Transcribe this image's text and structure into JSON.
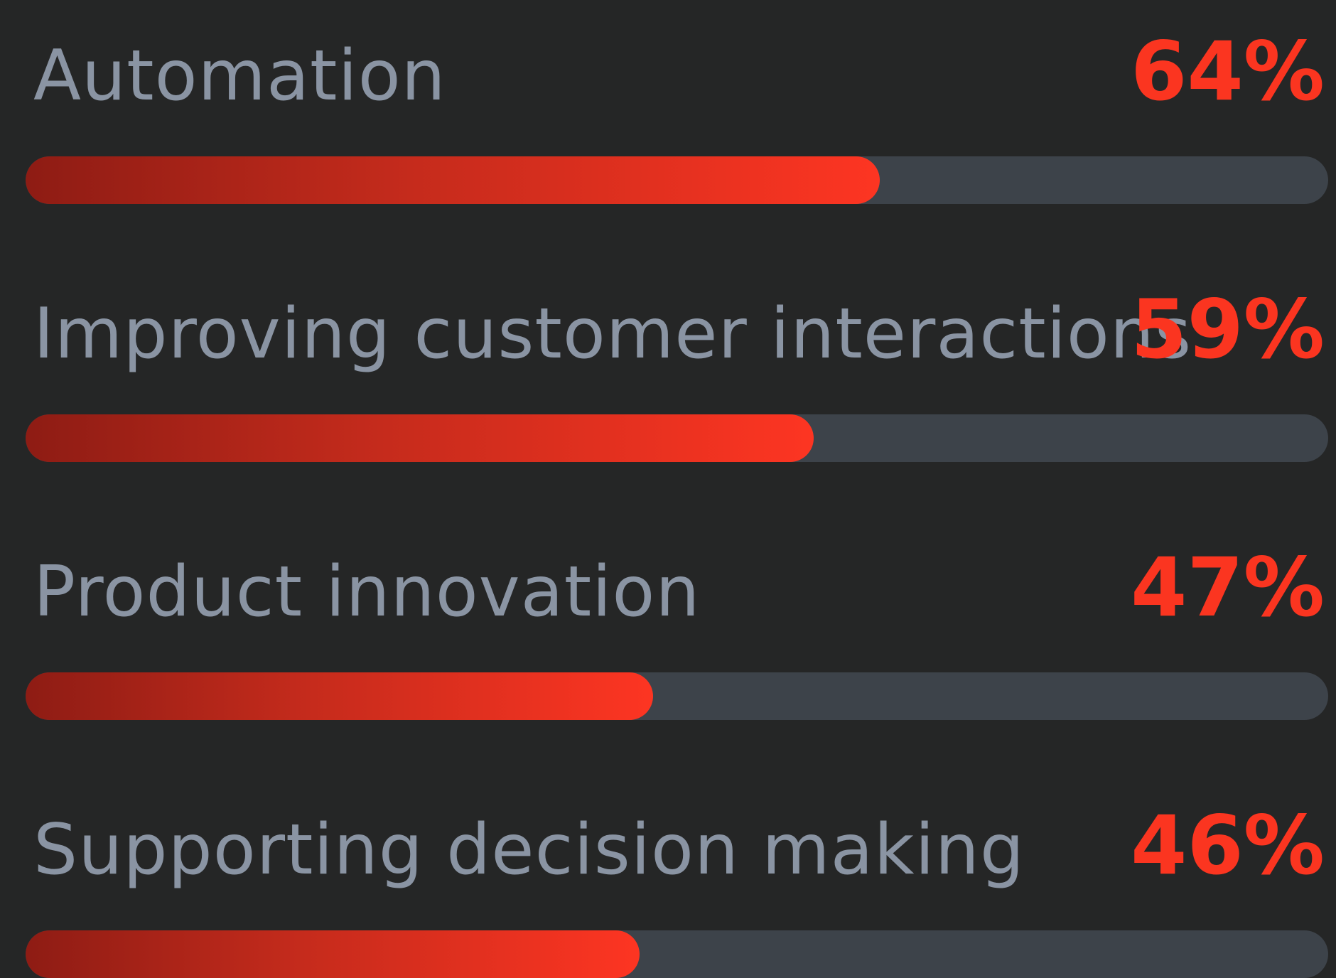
{
  "chart_data": {
    "type": "bar",
    "categories": [
      "Automation",
      "Improving customer interactions",
      "Product innovation",
      "Supporting decision making"
    ],
    "values": [
      64,
      59,
      47,
      46
    ],
    "value_labels": [
      "64%",
      "59%",
      "47%",
      "46%"
    ],
    "ylim": [
      0,
      100
    ],
    "orientation": "horizontal",
    "grid": false,
    "legend": "none"
  },
  "colors": {
    "background": "#252626",
    "label_text": "#8a94a3",
    "value_text": "#fb3520",
    "track": "#3d434a",
    "fill_start": "#8e1c14",
    "fill_end": "#fd3522"
  }
}
